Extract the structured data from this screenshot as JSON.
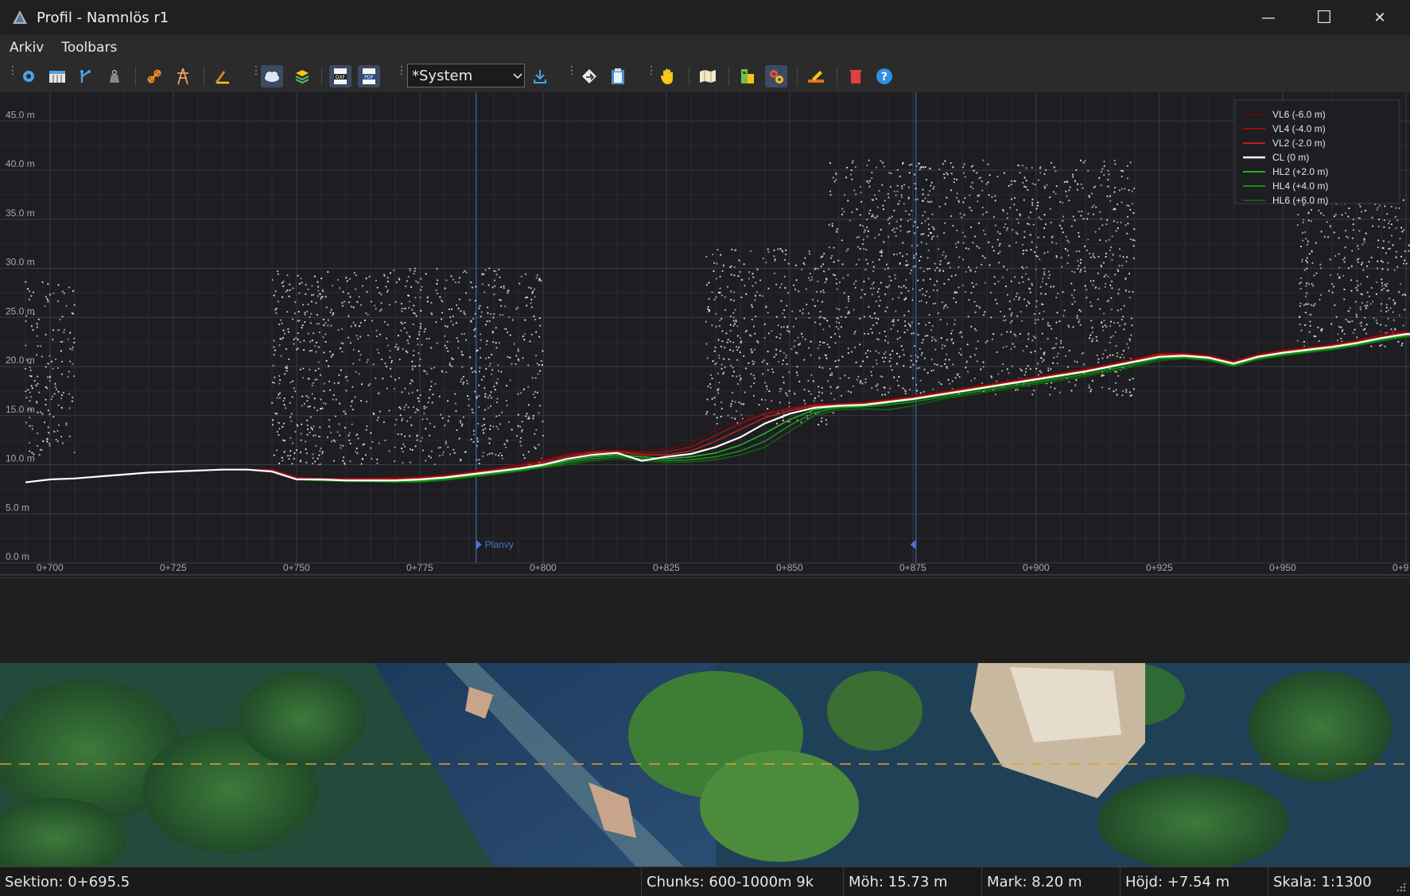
{
  "window": {
    "title": "Profil - Namnlös r1",
    "minimize_glyph": "—",
    "maximize_glyph": "☐",
    "close_glyph": "✕"
  },
  "menu": {
    "items": [
      "Arkiv",
      "Toolbars"
    ]
  },
  "toolbar": {
    "icons": [
      "settings-gear-icon",
      "ruler-calc-icon",
      "branch-icon",
      "weight-icon",
      "chain-link-icon",
      "power-tower-icon",
      "angle-ruler-icon",
      "point-cloud-icon",
      "layers-icon",
      "dxf-export-icon",
      "pdf-export-icon",
      "download-icon",
      "direction-sign-icon",
      "clipboard-icon",
      "pan-hand-icon",
      "map-book-icon",
      "building-icon",
      "gears-icon",
      "edit-icon",
      "delete-icon",
      "help-icon"
    ],
    "profile_dropdown": {
      "value": "*System"
    }
  },
  "profile_chart": {
    "y_ticks": [
      "0.0 m",
      "5.0 m",
      "10.0 m",
      "15.0 m",
      "20.0 m",
      "25.0 m",
      "30.0 m",
      "35.0 m",
      "40.0 m",
      "45.0 m"
    ],
    "x_ticks": [
      "0+700",
      "0+725",
      "0+750",
      "0+775",
      "0+800",
      "0+825",
      "0+850",
      "0+875",
      "0+900",
      "0+925",
      "0+950",
      "0+9"
    ],
    "plan_marker_label": "Planvy",
    "legend": [
      {
        "label": "VL6 (-6.0 m)",
        "color": "#5a0c0c"
      },
      {
        "label": "VL4 (-4.0 m)",
        "color": "#8a1414"
      },
      {
        "label": "VL2 (-2.0 m)",
        "color": "#c21e1e"
      },
      {
        "label": "CL (0 m)",
        "color": "#ffffff"
      },
      {
        "label": "HL2 (+2.0 m)",
        "color": "#22b322"
      },
      {
        "label": "HL4 (+4.0 m)",
        "color": "#1a8c1a"
      },
      {
        "label": "HL6 (+6.0 m)",
        "color": "#106010"
      }
    ]
  },
  "chart_data": {
    "type": "line",
    "xlabel": "",
    "ylabel": "",
    "xlim": [
      695,
      1000
    ],
    "ylim": [
      0,
      47
    ],
    "x": [
      695,
      700,
      705,
      710,
      715,
      720,
      725,
      730,
      735,
      740,
      745,
      750,
      755,
      760,
      765,
      770,
      775,
      780,
      785,
      790,
      795,
      800,
      805,
      810,
      815,
      820,
      825,
      830,
      835,
      840,
      845,
      850,
      855,
      860,
      865,
      870,
      875,
      880,
      885,
      890,
      895,
      900,
      905,
      910,
      915,
      920,
      925,
      930,
      935,
      940,
      945,
      950,
      955,
      960,
      965,
      970,
      975,
      980,
      985,
      990,
      995,
      1000
    ],
    "series": [
      {
        "name": "VL6 (-6.0 m)",
        "values": [
          8.2,
          8.5,
          8.6,
          8.8,
          9.0,
          9.2,
          9.3,
          9.4,
          9.5,
          9.5,
          9.5,
          8.8,
          8.6,
          8.6,
          8.6,
          8.7,
          8.8,
          9.0,
          9.3,
          9.6,
          10.0,
          10.6,
          11.2,
          11.4,
          11.5,
          11.4,
          11.6,
          12.2,
          13.5,
          14.5,
          15.3,
          15.8,
          16.2,
          16.2,
          16.4,
          16.7,
          17.0,
          17.4,
          17.8,
          18.2,
          18.6,
          19.0,
          19.4,
          19.8,
          20.3,
          20.8,
          21.4,
          21.4,
          21.2,
          20.6,
          21.3,
          21.7,
          22.0,
          22.3,
          22.7,
          23.5,
          23.6,
          23.4,
          23.3,
          23.3,
          23.3,
          23.3
        ]
      },
      {
        "name": "VL4 (-4.0 m)",
        "values": [
          8.2,
          8.5,
          8.6,
          8.8,
          9.0,
          9.2,
          9.3,
          9.4,
          9.5,
          9.5,
          9.5,
          8.7,
          8.6,
          8.6,
          8.6,
          8.6,
          8.7,
          8.9,
          9.2,
          9.5,
          9.9,
          10.4,
          11.0,
          11.3,
          11.4,
          11.2,
          11.3,
          11.8,
          13.0,
          14.2,
          15.2,
          15.7,
          16.1,
          16.2,
          16.3,
          16.6,
          16.9,
          17.3,
          17.7,
          18.1,
          18.5,
          18.9,
          19.3,
          19.7,
          20.2,
          20.7,
          21.3,
          21.3,
          21.1,
          20.5,
          21.2,
          21.6,
          21.9,
          22.2,
          22.6,
          23.2,
          23.5,
          23.3,
          23.3,
          23.3,
          23.3,
          23.3
        ]
      },
      {
        "name": "VL2 (-2.0 m)",
        "values": [
          8.2,
          8.5,
          8.6,
          8.8,
          9.0,
          9.2,
          9.3,
          9.4,
          9.5,
          9.5,
          9.4,
          8.6,
          8.5,
          8.5,
          8.5,
          8.5,
          8.6,
          8.8,
          9.1,
          9.4,
          9.7,
          10.2,
          10.8,
          11.2,
          11.3,
          11.0,
          11.0,
          11.4,
          12.4,
          13.6,
          14.8,
          15.5,
          16.0,
          16.1,
          16.2,
          16.5,
          16.8,
          17.2,
          17.6,
          18.0,
          18.4,
          18.8,
          19.2,
          19.6,
          20.1,
          20.6,
          21.2,
          21.2,
          21.0,
          20.4,
          21.1,
          21.5,
          21.8,
          22.1,
          22.5,
          23.0,
          23.4,
          23.3,
          23.3,
          23.3,
          23.3,
          23.3
        ]
      },
      {
        "name": "CL (0 m)",
        "values": [
          8.2,
          8.5,
          8.6,
          8.8,
          9.0,
          9.2,
          9.3,
          9.4,
          9.5,
          9.5,
          9.3,
          8.5,
          8.5,
          8.4,
          8.4,
          8.4,
          8.5,
          8.7,
          9.0,
          9.3,
          9.6,
          10.0,
          10.6,
          11.0,
          11.2,
          10.4,
          10.8,
          11.1,
          11.8,
          12.8,
          14.2,
          15.2,
          15.8,
          16.0,
          16.1,
          16.4,
          16.7,
          17.1,
          17.5,
          17.9,
          18.3,
          18.7,
          19.1,
          19.5,
          20.0,
          20.5,
          21.0,
          21.1,
          20.9,
          20.3,
          21.0,
          21.4,
          21.7,
          22.0,
          22.4,
          22.9,
          23.3,
          23.3,
          23.3,
          23.3,
          23.3,
          23.3
        ]
      },
      {
        "name": "HL2 (+2.0 m)",
        "values": [
          8.2,
          8.5,
          8.6,
          8.8,
          9.0,
          9.2,
          9.3,
          9.4,
          9.5,
          9.5,
          9.3,
          8.5,
          8.4,
          8.4,
          8.3,
          8.3,
          8.4,
          8.6,
          8.9,
          9.2,
          9.5,
          9.9,
          10.4,
          10.8,
          11.0,
          10.8,
          10.6,
          10.8,
          11.2,
          12.0,
          13.2,
          14.6,
          15.6,
          15.9,
          16.0,
          16.3,
          16.6,
          17.0,
          17.4,
          17.8,
          18.2,
          18.6,
          19.0,
          19.4,
          19.9,
          20.4,
          20.9,
          21.0,
          20.8,
          20.2,
          20.9,
          21.3,
          21.6,
          21.9,
          22.3,
          22.8,
          23.2,
          23.3,
          23.3,
          23.3,
          23.3,
          23.3
        ]
      },
      {
        "name": "HL4 (+4.0 m)",
        "values": [
          8.2,
          8.5,
          8.6,
          8.8,
          9.0,
          9.2,
          9.3,
          9.4,
          9.5,
          9.5,
          9.3,
          8.5,
          8.4,
          8.3,
          8.3,
          8.3,
          8.3,
          8.5,
          8.8,
          9.1,
          9.4,
          9.8,
          10.2,
          10.6,
          10.8,
          10.6,
          10.4,
          10.5,
          10.8,
          11.4,
          12.4,
          14.0,
          15.3,
          15.8,
          15.9,
          16.1,
          16.4,
          16.8,
          17.2,
          17.6,
          18.0,
          18.4,
          18.8,
          19.2,
          19.7,
          20.2,
          20.8,
          20.9,
          20.7,
          20.1,
          20.8,
          21.2,
          21.5,
          21.8,
          22.2,
          22.7,
          23.1,
          23.3,
          23.3,
          23.3,
          23.3,
          23.3
        ]
      },
      {
        "name": "HL6 (+6.0 m)",
        "values": [
          8.2,
          8.5,
          8.6,
          8.8,
          9.0,
          9.2,
          9.3,
          9.4,
          9.5,
          9.5,
          9.3,
          8.5,
          8.4,
          8.3,
          8.3,
          8.2,
          8.2,
          8.4,
          8.7,
          9.0,
          9.3,
          9.7,
          10.0,
          10.4,
          10.6,
          10.4,
          10.2,
          10.3,
          10.5,
          11.0,
          11.8,
          13.4,
          15.0,
          15.6,
          15.7,
          15.6,
          16.0,
          16.6,
          17.0,
          17.4,
          17.8,
          18.2,
          18.6,
          19.0,
          19.5,
          20.0,
          20.6,
          20.8,
          20.6,
          20.0,
          20.7,
          21.1,
          21.4,
          21.7,
          22.1,
          22.6,
          23.0,
          23.2,
          23.3,
          23.3,
          23.3,
          23.3
        ]
      }
    ],
    "point_cloud_regions": [
      {
        "x_range": [
          695,
          705
        ],
        "y_range": [
          11,
          29
        ]
      },
      {
        "x_range": [
          745,
          800
        ],
        "y_range": [
          10,
          30
        ]
      },
      {
        "x_range": [
          833,
          860
        ],
        "y_range": [
          14,
          32
        ]
      },
      {
        "x_range": [
          858,
          920
        ],
        "y_range": [
          17,
          41
        ]
      },
      {
        "x_range": [
          953,
          1000
        ],
        "y_range": [
          22,
          37
        ]
      }
    ],
    "grid": true,
    "legend_position": "top-right"
  },
  "status": {
    "section": "Sektion: 0+695.5",
    "chunks": "Chunks: 600-1000m 9k",
    "moh": "Möh: 15.73 m",
    "mark": "Mark: 8.20 m",
    "height": "Höjd: +7.54 m",
    "scale": "Skala: 1:1300"
  }
}
